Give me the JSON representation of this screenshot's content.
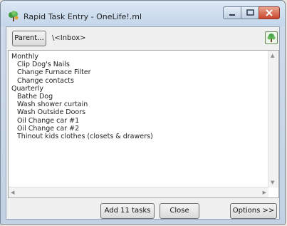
{
  "window": {
    "title": "Rapid Task Entry - OneLife!.ml",
    "icons": {
      "app": "app-tree-icon",
      "pick": "tree-picker-icon"
    }
  },
  "toolbar": {
    "parent_label": "Parent...",
    "path": "\\<Inbox>"
  },
  "editor": {
    "lines": [
      {
        "text": "Monthly",
        "indent": 0
      },
      {
        "text": "Clip Dog's Nails",
        "indent": 1
      },
      {
        "text": "Change Furnace Filter",
        "indent": 1
      },
      {
        "text": "Change contacts",
        "indent": 1
      },
      {
        "text": "Quarterly",
        "indent": 0
      },
      {
        "text": "Bathe Dog",
        "indent": 1
      },
      {
        "text": "Wash shower curtain",
        "indent": 1
      },
      {
        "text": "Wash Outside Doors",
        "indent": 1
      },
      {
        "text": "Oil Change car #1",
        "indent": 1
      },
      {
        "text": "Oil Change car #2",
        "indent": 1
      },
      {
        "text": "Thinout kids clothes (closets & drawers)",
        "indent": 1
      }
    ]
  },
  "footer": {
    "add_label": "Add 11 tasks",
    "close_label": "Close",
    "options_label": "Options >>"
  },
  "colors": {
    "titlebar": "#c4d6ea",
    "close_button": "#c8452b"
  }
}
